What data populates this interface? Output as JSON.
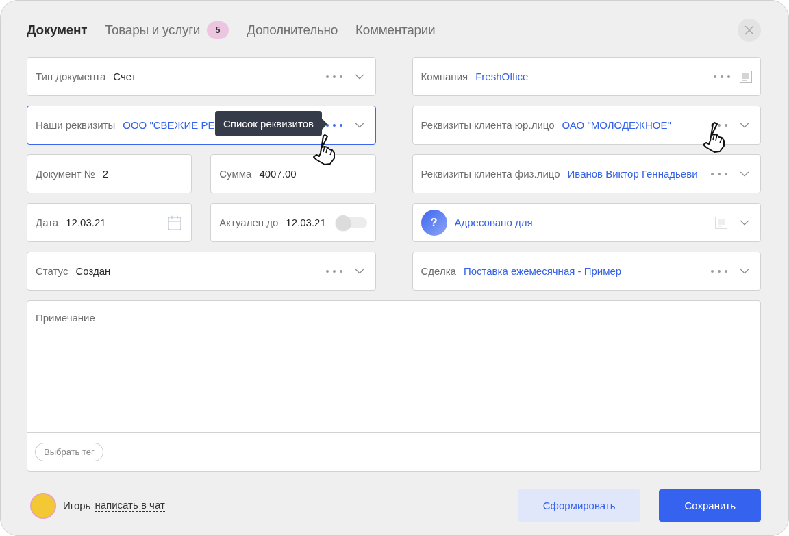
{
  "tabs": [
    {
      "label": "Документ",
      "selected": true
    },
    {
      "label": "Товары и услуги",
      "selected": false,
      "badge": "5"
    },
    {
      "label": "Дополнительно",
      "selected": false
    },
    {
      "label": "Комментарии",
      "selected": false
    }
  ],
  "left_rows": [
    [
      {
        "kind": "select",
        "label": "Тип документа",
        "value": "Счет",
        "link": false
      }
    ],
    [
      {
        "kind": "select",
        "label": "Наши реквизиты",
        "value": "ООО \"СВЕЖИЕ РЕ",
        "link": true,
        "focused": true,
        "hovered": true,
        "tooltip": "Список реквизитов"
      }
    ],
    [
      {
        "kind": "text",
        "label": "Документ №",
        "value": "2",
        "link": false
      },
      {
        "kind": "text",
        "label": "Сумма",
        "value": "4007.00",
        "link": false
      }
    ],
    [
      {
        "kind": "date",
        "label": "Дата",
        "value": "12.03.21",
        "link": false
      },
      {
        "kind": "toggle",
        "label": "Актуален до",
        "value": "12.03.21",
        "link": false,
        "on": false
      }
    ],
    [
      {
        "kind": "select",
        "label": "Статус",
        "value": "Создан",
        "link": false
      }
    ]
  ],
  "right_fields": [
    {
      "kind": "reference",
      "label": "Компания",
      "value": "FreshOffice",
      "link": true
    },
    {
      "kind": "select",
      "label": "Реквизиты клиента юр.лицо",
      "value": "ОАО \"МОЛОДЕЖНОЕ\"",
      "link": true,
      "hovered": true
    },
    {
      "kind": "select",
      "label": "Реквизиты клиента физ.лицо",
      "value": "Иванов Виктор Геннадьеви",
      "link": true
    },
    {
      "kind": "addressee",
      "value": "Адресовано для",
      "link": true,
      "icon_text": "?"
    },
    {
      "kind": "select",
      "label": "Сделка",
      "value": "Поставка ежемесячная - Пример",
      "link": true
    }
  ],
  "note": {
    "placeholder": "Примечание",
    "tag_button": "Выбрать тег"
  },
  "footer": {
    "user": "Игорь",
    "chat_link": "написать в чат",
    "buttons": [
      {
        "label": "Сформировать",
        "kind": "secondary"
      },
      {
        "label": "Сохранить",
        "kind": "primary"
      }
    ]
  }
}
